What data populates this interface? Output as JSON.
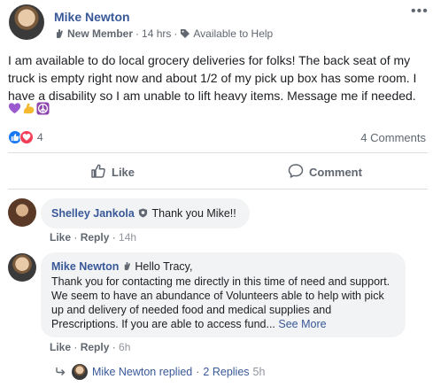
{
  "post": {
    "author": "Mike Newton",
    "badge": "New Member",
    "time": "14 hrs",
    "tag": "Available to Help",
    "text": "I am available to do local grocery deliveries for folks! The back seat of my truck is empty right now and about 1/2 of my pick up box has some room. I have a disability so I am unable to lift heavy items. Message me if needed.",
    "emojis": [
      "purple-heart-icon",
      "flexed-biceps-icon",
      "peace-symbol-icon"
    ],
    "reaction_count": "4",
    "comments_count": "4 Comments"
  },
  "actions": {
    "like": "Like",
    "comment": "Comment"
  },
  "comments": [
    {
      "author": "Shelley Jankola",
      "text": "Thank you Mike!!",
      "like": "Like",
      "reply": "Reply",
      "time": "14h"
    },
    {
      "author": "Mike Newton",
      "greeting": "Hello Tracy,",
      "text": "Thank you for contacting me directly in this time of need and support. We seem to have an abundance of Volunteers able to help with pick up and delivery of needed food and medical supplies and Prescriptions. If you are able to access fund...",
      "see_more": "See More",
      "like": "Like",
      "reply": "Reply",
      "time": "6h"
    }
  ],
  "replies": {
    "author_replied": "Mike Newton replied",
    "count": "2 Replies",
    "time": "5h"
  },
  "colors": {
    "link": "#385898",
    "secondary_text": "#606770",
    "bubble": "#f2f3f5",
    "like_blue": "#1877f2",
    "love_red": "#f33e58"
  }
}
